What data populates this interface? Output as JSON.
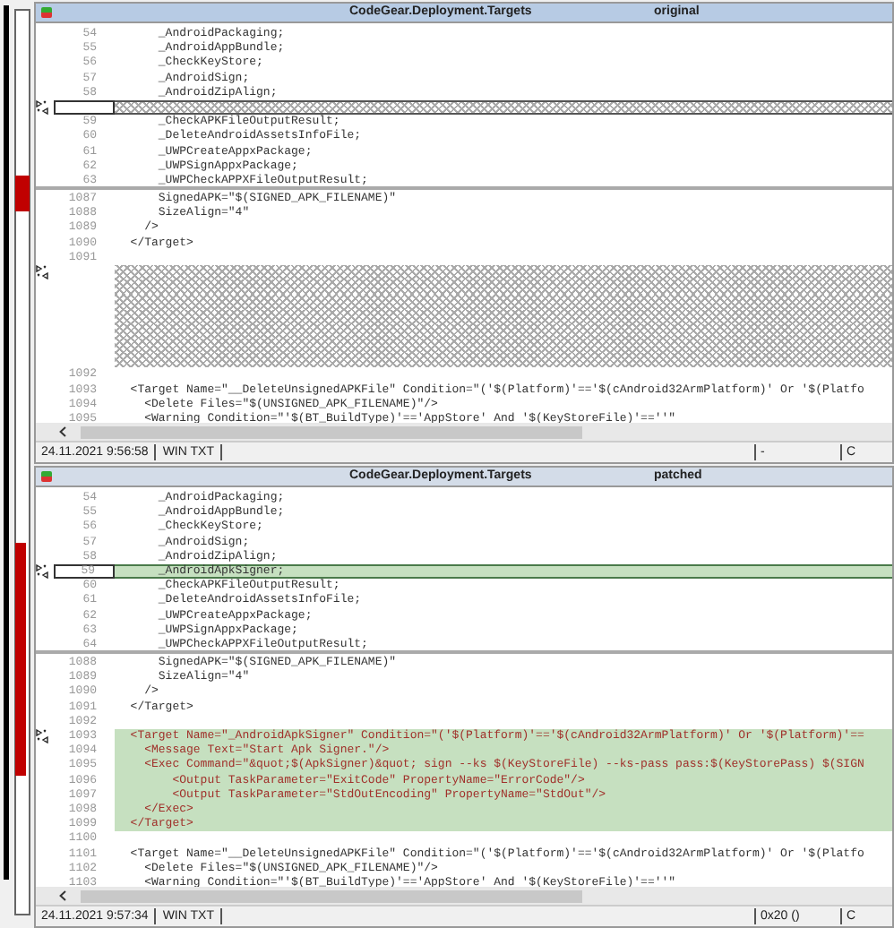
{
  "panes": [
    {
      "title": "CodeGear.Deployment.Targets",
      "label": "original",
      "selected": false,
      "top_lines": [
        {
          "kind": "line",
          "number": "54",
          "text": "      _AndroidPackaging;",
          "added": false,
          "marker": false
        },
        {
          "kind": "line",
          "number": "55",
          "text": "      _AndroidAppBundle;",
          "added": false,
          "marker": false
        },
        {
          "kind": "line",
          "number": "56",
          "text": "      _CheckKeyStore;",
          "added": false,
          "marker": false
        },
        {
          "kind": "line",
          "number": "57",
          "text": "      _AndroidSign;",
          "added": false,
          "marker": false
        },
        {
          "kind": "line",
          "number": "58",
          "text": "      _AndroidZipAlign;",
          "added": false,
          "marker": false
        },
        {
          "kind": "gap",
          "marker": true
        },
        {
          "kind": "line",
          "number": "59",
          "text": "      _CheckAPKFileOutputResult;",
          "added": false,
          "marker": false
        },
        {
          "kind": "line",
          "number": "60",
          "text": "      _DeleteAndroidAssetsInfoFile;",
          "added": false,
          "marker": false
        },
        {
          "kind": "line",
          "number": "61",
          "text": "      _UWPCreateAppxPackage;",
          "added": false,
          "marker": false
        },
        {
          "kind": "line",
          "number": "62",
          "text": "      _UWPSignAppxPackage;",
          "added": false,
          "marker": false
        },
        {
          "kind": "line",
          "number": "63",
          "text": "      _UWPCheckAPPXFileOutputResult;",
          "added": false,
          "marker": false
        }
      ],
      "bottom_lines": [
        {
          "kind": "line",
          "number": "1087",
          "text": "      SignedAPK=\"$(SIGNED_APK_FILENAME)\"",
          "added": false,
          "marker": false
        },
        {
          "kind": "line",
          "number": "1088",
          "text": "      SizeAlign=\"4\"",
          "added": false,
          "marker": false
        },
        {
          "kind": "line",
          "number": "1089",
          "text": "    />",
          "added": false,
          "marker": false
        },
        {
          "kind": "line",
          "number": "1090",
          "text": "  </Target>",
          "added": false,
          "marker": false
        },
        {
          "kind": "line",
          "number": "1091",
          "added": false,
          "marker": false
        },
        {
          "kind": "gap",
          "marker": true
        },
        {
          "kind": "gap",
          "marker": false
        },
        {
          "kind": "gap",
          "marker": false
        },
        {
          "kind": "gap",
          "marker": false
        },
        {
          "kind": "gap",
          "marker": false
        },
        {
          "kind": "gap",
          "marker": false
        },
        {
          "kind": "gap",
          "marker": false
        },
        {
          "kind": "line",
          "number": "1092",
          "added": false,
          "marker": false
        },
        {
          "kind": "line",
          "number": "1093",
          "text": "  <Target Name=\"__DeleteUnsignedAPKFile\" Condition=\"('$(Platform)'=='$(cAndroid32ArmPlatform)' Or '$(Platfo",
          "added": false,
          "marker": false
        },
        {
          "kind": "line",
          "number": "1094",
          "text": "    <Delete Files=\"$(UNSIGNED_APK_FILENAME)\"/>",
          "added": false,
          "marker": false
        },
        {
          "kind": "line",
          "number": "1095",
          "text": "    <Warning Condition=\"'$(BT_BuildType)'=='AppStore' And '$(KeyStoreFile)'==''\"",
          "added": false,
          "marker": false
        }
      ],
      "status": [
        "24.11.2021 9:56:58",
        "WIN TXT",
        "-",
        "C"
      ]
    },
    {
      "title": "CodeGear.Deployment.Targets",
      "label": "patched",
      "selected": true,
      "top_lines": [
        {
          "kind": "line",
          "number": "54",
          "text": "      _AndroidPackaging;",
          "added": false,
          "marker": false
        },
        {
          "kind": "line",
          "number": "55",
          "text": "      _AndroidAppBundle;",
          "added": false,
          "marker": false
        },
        {
          "kind": "line",
          "number": "56",
          "text": "      _CheckKeyStore;",
          "added": false,
          "marker": false
        },
        {
          "kind": "line",
          "number": "57",
          "text": "      _AndroidSign;",
          "added": false,
          "marker": false
        },
        {
          "kind": "line",
          "number": "58",
          "text": "      _AndroidZipAlign;",
          "added": false,
          "marker": false
        },
        {
          "kind": "line",
          "number": "59",
          "text": "      _AndroidApkSigner;",
          "added": true,
          "marker": true
        },
        {
          "kind": "line",
          "number": "60",
          "text": "      _CheckAPKFileOutputResult;",
          "added": false,
          "marker": false
        },
        {
          "kind": "line",
          "number": "61",
          "text": "      _DeleteAndroidAssetsInfoFile;",
          "added": false,
          "marker": false
        },
        {
          "kind": "line",
          "number": "62",
          "text": "      _UWPCreateAppxPackage;",
          "added": false,
          "marker": false
        },
        {
          "kind": "line",
          "number": "63",
          "text": "      _UWPSignAppxPackage;",
          "added": false,
          "marker": false
        },
        {
          "kind": "line",
          "number": "64",
          "text": "      _UWPCheckAPPXFileOutputResult;",
          "added": false,
          "marker": false
        }
      ],
      "bottom_lines": [
        {
          "kind": "line",
          "number": "1088",
          "text": "      SignedAPK=\"$(SIGNED_APK_FILENAME)\"",
          "added": false,
          "marker": false
        },
        {
          "kind": "line",
          "number": "1089",
          "text": "      SizeAlign=\"4\"",
          "added": false,
          "marker": false
        },
        {
          "kind": "line",
          "number": "1090",
          "text": "    />",
          "added": false,
          "marker": false
        },
        {
          "kind": "line",
          "number": "1091",
          "text": "  </Target>",
          "added": false,
          "marker": false
        },
        {
          "kind": "line",
          "number": "1092",
          "added": false,
          "marker": false
        },
        {
          "kind": "line",
          "number": "1093",
          "text": "  <Target Name=\"_AndroidApkSigner\" Condition=\"('$(Platform)'=='$(cAndroid32ArmPlatform)' Or '$(Platform)'==",
          "added": true,
          "marker": true
        },
        {
          "kind": "line",
          "number": "1094",
          "text": "    <Message Text=\"Start Apk Signer.\"/>",
          "added": true,
          "marker": false
        },
        {
          "kind": "line",
          "number": "1095",
          "text": "    <Exec Command=\"&quot;$(ApkSigner)&quot; sign --ks $(KeyStoreFile) --ks-pass pass:$(KeyStorePass) $(SIGN",
          "added": true,
          "marker": false
        },
        {
          "kind": "line",
          "number": "1096",
          "text": "        <Output TaskParameter=\"ExitCode\" PropertyName=\"ErrorCode\"/>",
          "added": true,
          "marker": false
        },
        {
          "kind": "line",
          "number": "1097",
          "text": "        <Output TaskParameter=\"StdOutEncoding\" PropertyName=\"StdOut\"/>",
          "added": true,
          "marker": false
        },
        {
          "kind": "line",
          "number": "1098",
          "text": "    </Exec>",
          "added": true,
          "marker": false
        },
        {
          "kind": "line",
          "number": "1099",
          "text": "  </Target>",
          "added": true,
          "marker": false
        },
        {
          "kind": "line",
          "number": "1100",
          "added": false,
          "marker": false
        },
        {
          "kind": "line",
          "number": "1101",
          "text": "  <Target Name=\"__DeleteUnsignedAPKFile\" Condition=\"('$(Platform)'=='$(cAndroid32ArmPlatform)' Or '$(Platfo",
          "added": false,
          "marker": false
        },
        {
          "kind": "line",
          "number": "1102",
          "text": "    <Delete Files=\"$(UNSIGNED_APK_FILENAME)\"/>",
          "added": false,
          "marker": false
        },
        {
          "kind": "line",
          "number": "1103",
          "text": "    <Warning Condition=\"'$(BT_BuildType)'=='AppStore' And '$(KeyStoreFile)'==''\"",
          "added": false,
          "marker": false
        }
      ],
      "status": [
        "24.11.2021 9:57:34",
        "WIN TXT",
        "0x20 ()",
        "C"
      ]
    }
  ]
}
